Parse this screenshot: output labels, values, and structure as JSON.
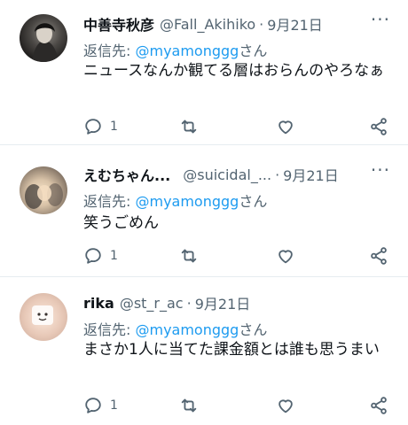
{
  "tweets": [
    {
      "name": "中善寺秋彦",
      "handle": "@Fall_Akihiko",
      "sep": "·",
      "time": "9月21日",
      "reply_prefix": "返信先: ",
      "reply_to": "@myamonggg",
      "reply_suffix": "さん",
      "body": "ニュースなんか観てる層はおらんのやろなぁ",
      "reply_count": "1"
    },
    {
      "name": "えむちゃん...",
      "handle": "@suicidal_...",
      "sep": "·",
      "time": "9月21日",
      "reply_prefix": "返信先: ",
      "reply_to": "@myamonggg",
      "reply_suffix": "さん",
      "body": "笑うごめん",
      "reply_count": "1"
    },
    {
      "name": "rika",
      "handle": "@st_r_ac",
      "sep": "·",
      "time": "9月21日",
      "reply_prefix": "返信先: ",
      "reply_to": "@myamonggg",
      "reply_suffix": "さん",
      "body": "まさか1人に当てた課金額とは誰も思うまい",
      "reply_count": "1"
    }
  ],
  "icons": {
    "reply": "reply-icon",
    "retweet": "retweet-icon",
    "like": "heart-icon",
    "share": "share-icon",
    "more": "more-icon"
  },
  "colors": {
    "link": "#1d9bf0",
    "muted": "#536471",
    "text": "#0f1419"
  }
}
